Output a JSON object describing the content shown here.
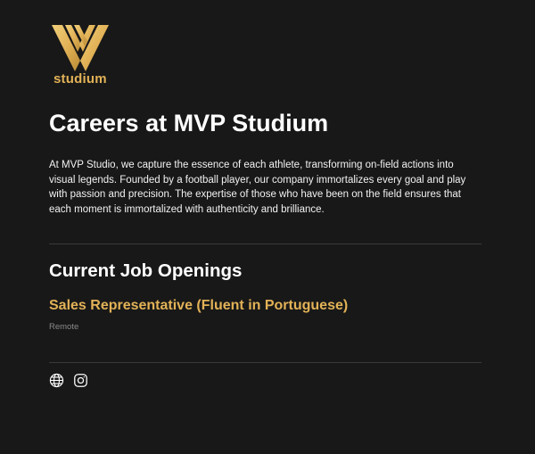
{
  "brand": {
    "logo_icon": "mvp-v-logo",
    "wordmark": "studium",
    "accent_color": "#e2b257"
  },
  "page": {
    "title": "Careers at MVP Studium",
    "intro": "At MVP Studio, we capture the essence of each athlete, transforming on-field actions into visual legends. Founded by a football player, our company immortalizes every goal and play with passion and precision. The expertise of those who have been on the field ensures that each moment is immortalized with authenticity and brilliance."
  },
  "jobs": {
    "heading": "Current Job Openings",
    "items": [
      {
        "title": "Sales Representative (Fluent in Portuguese)",
        "location": "Remote"
      }
    ]
  },
  "footer": {
    "icons": [
      "globe-icon",
      "instagram-icon"
    ]
  },
  "colors": {
    "background": "#181818",
    "text": "#ffffff",
    "muted": "#8a8a8a",
    "divider": "#3a3a3a"
  }
}
